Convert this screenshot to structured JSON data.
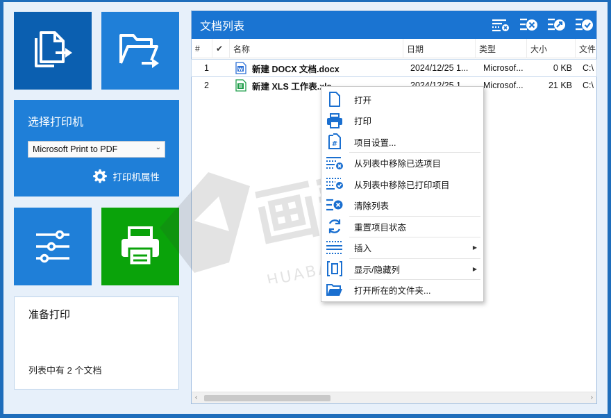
{
  "left": {
    "printer_title": "选择打印机",
    "printer_selected": "Microsoft Print to PDF",
    "printer_props": "打印机属性",
    "status_title": "准备打印",
    "status_count": "列表中有 2 个文档"
  },
  "list": {
    "title": "文档列表",
    "columns": [
      "#",
      "✔",
      "名称",
      "日期",
      "类型",
      "大小",
      "文件"
    ],
    "rows": [
      {
        "num": "1",
        "name": "新建 DOCX 文档.docx",
        "date": "2024/12/25 1...",
        "type": "Microsof...",
        "size": "0 KB",
        "path": "C:\\"
      },
      {
        "num": "2",
        "name": "新建 XLS 工作表.xls",
        "date": "2024/12/25 1...",
        "type": "Microsof...",
        "size": "21 KB",
        "path": "C:\\"
      }
    ]
  },
  "menu": {
    "items": [
      {
        "label": "打开",
        "icon": "file-icon"
      },
      {
        "label": "打印",
        "icon": "printer-icon"
      },
      {
        "label": "项目设置...",
        "icon": "file-settings-icon"
      },
      {
        "label": "从列表中移除已选项目",
        "icon": "remove-selected-icon"
      },
      {
        "label": "从列表中移除已打印项目",
        "icon": "remove-printed-icon"
      },
      {
        "label": "清除列表",
        "icon": "clear-list-icon"
      },
      {
        "label": "重置项目状态",
        "icon": "reset-icon"
      },
      {
        "label": "插入",
        "icon": "insert-icon"
      },
      {
        "label": "显示/隐藏列",
        "icon": "columns-icon"
      },
      {
        "label": "打开所在的文件夹...",
        "icon": "folder-icon"
      }
    ]
  },
  "watermark": {
    "logo_text": "画帮手",
    "url_text": "HUABANGSHOU.COM"
  },
  "colors": {
    "accent": "#1a74d2",
    "dark_tile": "#0b5fb0",
    "print_tile": "#0aa30a",
    "icon_blue": "#1a6fd0"
  }
}
